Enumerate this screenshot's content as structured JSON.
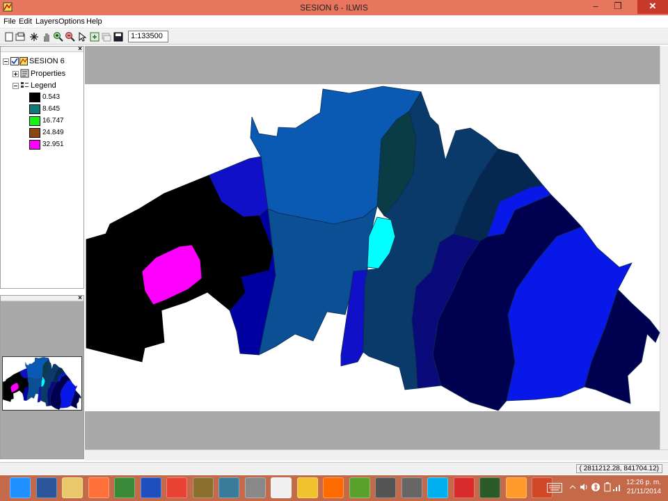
{
  "window": {
    "title": "SESION 6 - ILWIS"
  },
  "menu": [
    "File",
    "Edit",
    "Layers",
    "Options",
    "Help"
  ],
  "toolbar": {
    "scale": "1:133500"
  },
  "tree": {
    "root": "SESION 6",
    "properties": "Properties",
    "legend": "Legend",
    "legend_items": [
      {
        "value": "0.543",
        "color": "#000000"
      },
      {
        "value": "8.645",
        "color": "#0f7a7a"
      },
      {
        "value": "16.747",
        "color": "#18f018"
      },
      {
        "value": "24.849",
        "color": "#8b4513"
      },
      {
        "value": "32.951",
        "color": "#ff00ff"
      }
    ]
  },
  "map": {
    "colors": {
      "black": "#000000",
      "magenta": "#ff00ff",
      "blue_mid": "#0a5ab4",
      "blue_steel": "#0b4f95",
      "royal": "#1010c8",
      "navy": "#0000a0",
      "darknavy": "#000050",
      "teal_dark": "#0a3c46",
      "cyan": "#00ffff",
      "bright_blue": "#0818e8",
      "slate": "#0a3a6a",
      "deep": "#062850"
    }
  },
  "status": {
    "coords": "( 2811212.28,  841704.12)"
  },
  "taskbar": {
    "apps": [
      "internet-explorer",
      "word",
      "file-explorer",
      "firefox-like",
      "w-app",
      "media-player",
      "chrome",
      "winrar",
      "search-app",
      "calculator",
      "notepad",
      "norton",
      "firefox",
      "qgis",
      "pen-tool",
      "dbase",
      "skype",
      "acrobat",
      "ilwis",
      "media",
      "powerpoint"
    ],
    "time": "12:26 p. m.",
    "date": "21/11/2014"
  }
}
